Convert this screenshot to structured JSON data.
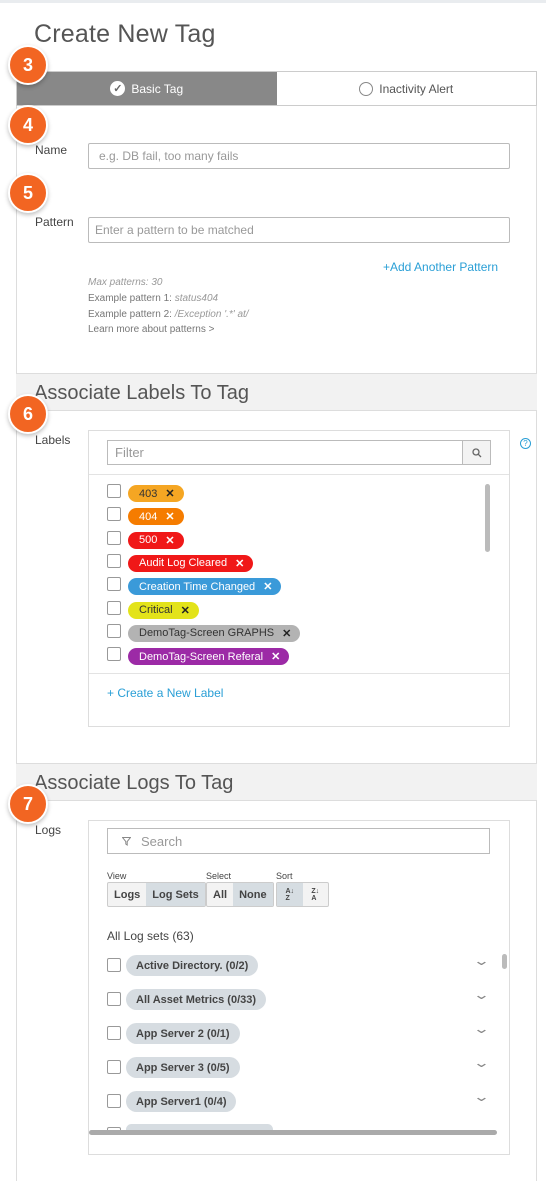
{
  "page": {
    "title": "Create New Tag"
  },
  "steps": [
    "3",
    "4",
    "5",
    "6",
    "7"
  ],
  "tabs": {
    "basic": "Basic Tag",
    "inactivity": "Inactivity Alert"
  },
  "name_field": {
    "label": "Name",
    "placeholder": "e.g. DB fail, too many fails"
  },
  "pattern_field": {
    "label": "Pattern",
    "placeholder": "Enter a pattern to be matched",
    "add_pattern": "+Add Another Pattern",
    "max_patterns": "Max patterns: 30",
    "example1_label": "Example pattern 1: ",
    "example1_value": "status404",
    "example2_label": "Example pattern 2: ",
    "example2_value": "/Exception '.*' at/",
    "learn_more": "Learn more about patterns >"
  },
  "labels_section": {
    "heading": "Associate Labels To Tag",
    "label": "Labels",
    "help_icon": "?",
    "filter_placeholder": "Filter",
    "items": [
      {
        "name": "403",
        "color": "#f5a623",
        "text_color": "#333"
      },
      {
        "name": "404",
        "color": "#f57c00",
        "text_color": "#fff"
      },
      {
        "name": "500",
        "color": "#f01818",
        "text_color": "#fff"
      },
      {
        "name": "Audit Log Cleared",
        "color": "#f01818",
        "text_color": "#fff"
      },
      {
        "name": "Creation Time Changed",
        "color": "#3a9ad9",
        "text_color": "#fff"
      },
      {
        "name": "Critical",
        "color": "#e3e31a",
        "text_color": "#333"
      },
      {
        "name": "DemoTag-Screen GRAPHS",
        "color": "#b3b3b3",
        "text_color": "#333"
      },
      {
        "name": "DemoTag-Screen Referal",
        "color": "#9c2aa6",
        "text_color": "#fff"
      }
    ],
    "create_label": "+ Create a New Label"
  },
  "logs_section": {
    "heading": "Associate Logs To Tag",
    "label": "Logs",
    "search_placeholder": "Search",
    "view_label": "View",
    "view_options": [
      "Logs",
      "Log Sets"
    ],
    "select_label": "Select",
    "select_options": [
      "All",
      "None"
    ],
    "sort_label": "Sort",
    "summary": "All Log sets (63)",
    "items": [
      "Active Directory. (0/2)",
      "All Asset Metrics (0/33)",
      "App Server 2 (0/1)",
      "App Server 3 (0/5)",
      "App Server1 (0/4)"
    ]
  },
  "icons": {
    "check": "check-icon",
    "search": "search-icon",
    "filter": "filter-icon",
    "chevron": "chevron-down-icon"
  }
}
